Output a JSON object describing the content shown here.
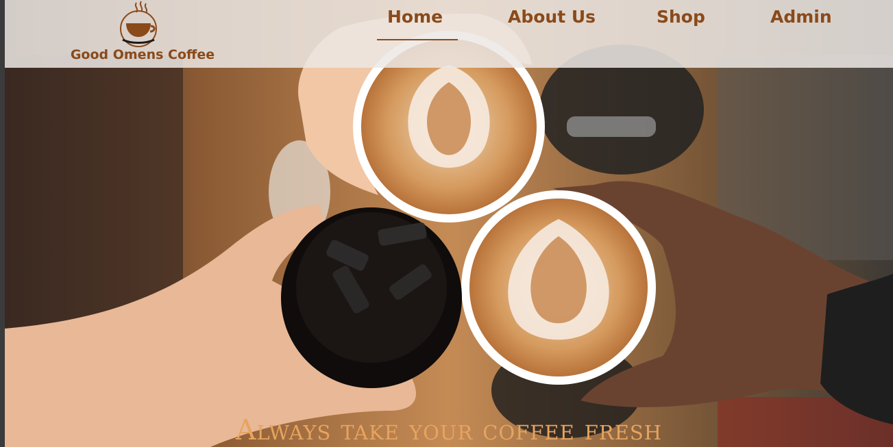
{
  "brand": {
    "name": "Good Omens Coffee",
    "logo_icon": "coffee-cup-logo-icon"
  },
  "nav": {
    "active": "Home",
    "items": [
      {
        "label": "Home"
      },
      {
        "label": "About Us"
      },
      {
        "label": "Shop"
      },
      {
        "label": "Admin"
      }
    ]
  },
  "hero": {
    "tagline": "Always take your coffee fresh",
    "image_icon": "coffee-cheers-photo"
  },
  "colors": {
    "brand": "#8a4a1a",
    "tagline": "#e7a45f",
    "nav_background": "#ece8e4"
  }
}
